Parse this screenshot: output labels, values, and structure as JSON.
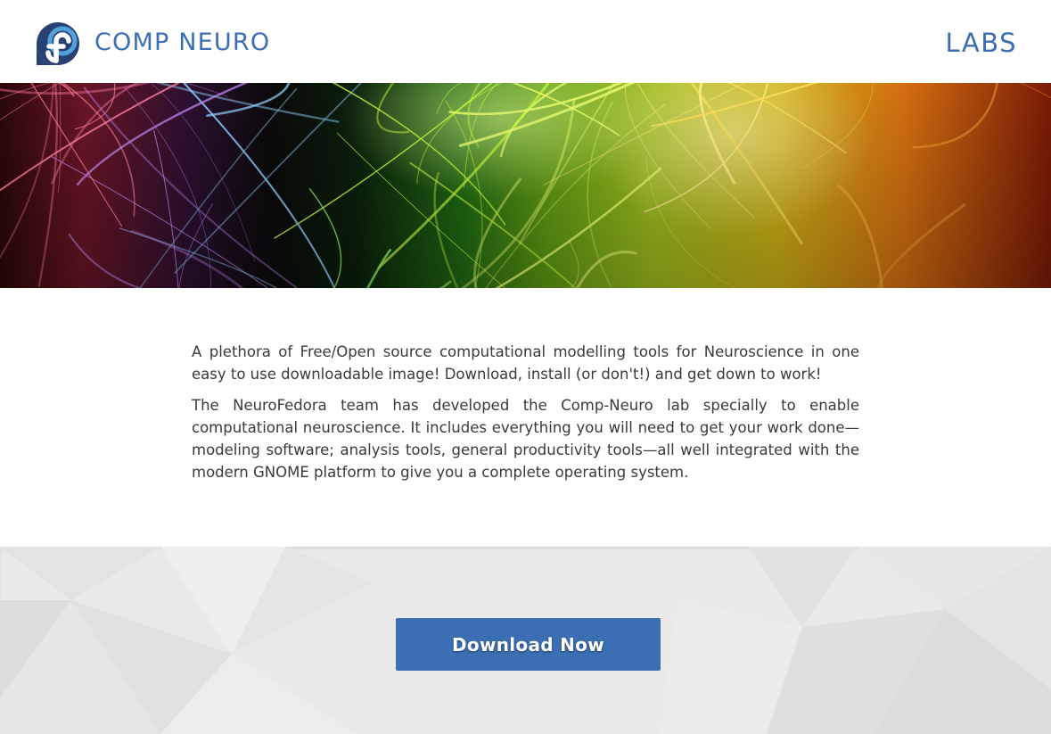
{
  "header": {
    "logo_icon": "fedora-logo-icon",
    "brand_title": "COMP NEURO",
    "labs_link": "LABS"
  },
  "hero": {
    "image": "neuron-network-rainbow-banner"
  },
  "description": {
    "paragraphs": [
      "A plethora of Free/Open source computational modelling tools for Neuroscience in one easy to use downloadable image! Download, install (or don't!) and get down to work!",
      "The NeuroFedora team has developed the Comp-Neuro lab specially to enable computational neuroscience. It includes everything you will need to get your work done—modeling software; analysis tools, general productivity tools—all well integrated with the modern GNOME platform to give you a complete operating system."
    ]
  },
  "download": {
    "button_label": "Download Now"
  },
  "colors": {
    "brand_blue": "#3c6eb4",
    "text": "#3a3a3a",
    "band_bg": "#e9e9e9"
  }
}
